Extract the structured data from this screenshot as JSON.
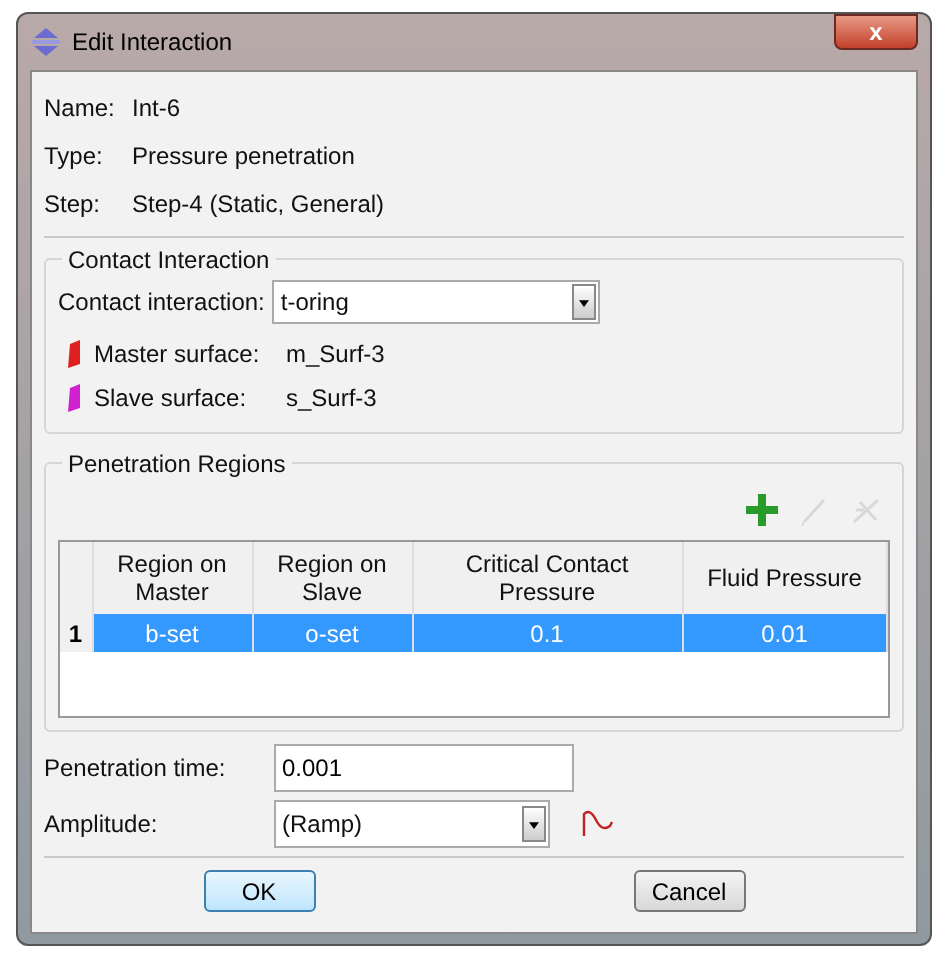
{
  "window": {
    "title": "Edit Interaction",
    "close": "x"
  },
  "info": [
    {
      "label": "Name:",
      "value": "Int-6"
    },
    {
      "label": "Type:",
      "value": "Pressure penetration"
    },
    {
      "label": "Step:",
      "value": "Step-4 (Static, General)"
    }
  ],
  "contact_group": {
    "title": "Contact Interaction",
    "label": "Contact interaction:",
    "value": "t-oring",
    "surfaces": [
      {
        "label": "Master surface:",
        "value": "m_Surf-3",
        "color": "#e02020"
      },
      {
        "label": "Slave surface:",
        "value": "s_Surf-3",
        "color": "#d020d0"
      }
    ]
  },
  "regions_group": {
    "title": "Penetration Regions",
    "toolbar": [
      {
        "kind": "add",
        "disabled": false
      },
      {
        "kind": "edit",
        "disabled": true
      },
      {
        "kind": "delete",
        "disabled": true
      }
    ],
    "table": {
      "columns": [
        "Region on Master",
        "Region on Slave",
        "Critical Contact Pressure",
        "Fluid Pressure"
      ],
      "rows": [
        {
          "index": "1",
          "cells": [
            "b-set",
            "o-set",
            "0.1",
            "0.01"
          ],
          "selected": true
        }
      ]
    }
  },
  "penetration_time": {
    "label": "Penetration time:",
    "value": "0.001"
  },
  "amplitude": {
    "label": "Amplitude:",
    "value": "(Ramp)"
  },
  "buttons": [
    "OK",
    "Cancel"
  ]
}
